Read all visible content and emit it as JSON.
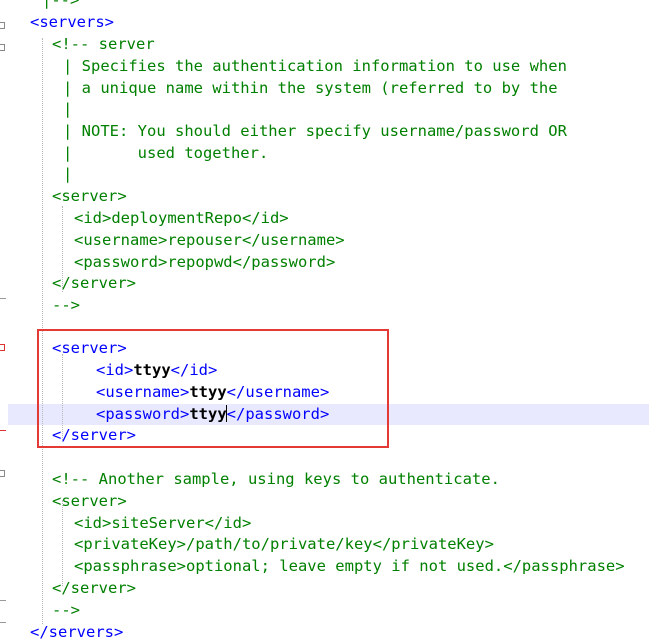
{
  "colors": {
    "tag": "#0000ff",
    "comment": "#008000",
    "text": "#000000",
    "current_line": "#e8e8ff",
    "annotation_box": "#e53935"
  },
  "editor": {
    "lines": [
      {
        "segments": [
          {
            "t": "|-->",
            "c": "cmt"
          }
        ]
      },
      {
        "segments": [
          {
            "t": "<servers>",
            "c": "tag"
          }
        ]
      },
      {
        "segments": [
          {
            "t": "<!-- server",
            "c": "cmt"
          }
        ]
      },
      {
        "segments": [
          {
            "t": "| Specifies the authentication information to use when",
            "c": "cmt"
          }
        ]
      },
      {
        "segments": [
          {
            "t": "| a unique name within the system (referred to by the",
            "c": "cmt"
          }
        ]
      },
      {
        "segments": [
          {
            "t": "|",
            "c": "cmt"
          }
        ]
      },
      {
        "segments": [
          {
            "t": "| NOTE: You should either specify username/password OR",
            "c": "cmt"
          }
        ]
      },
      {
        "segments": [
          {
            "t": "|       used together.",
            "c": "cmt"
          }
        ]
      },
      {
        "segments": [
          {
            "t": "|",
            "c": "cmt"
          }
        ]
      },
      {
        "segments": [
          {
            "t": "<server>",
            "c": "cmt"
          }
        ]
      },
      {
        "segments": [
          {
            "t": "<id>deploymentRepo</id>",
            "c": "cmt"
          }
        ]
      },
      {
        "segments": [
          {
            "t": "<username>repouser</username>",
            "c": "cmt"
          }
        ]
      },
      {
        "segments": [
          {
            "t": "<password>repopwd</password>",
            "c": "cmt"
          }
        ]
      },
      {
        "segments": [
          {
            "t": "</server>",
            "c": "cmt"
          }
        ]
      },
      {
        "segments": [
          {
            "t": "-->",
            "c": "cmt"
          }
        ]
      },
      {
        "segments": []
      },
      {
        "segments": [
          {
            "t": "<server>",
            "c": "tag"
          }
        ]
      },
      {
        "segments": [
          {
            "t": "<id>",
            "c": "tag"
          },
          {
            "t": "ttyy",
            "c": "txt"
          },
          {
            "t": "</id>",
            "c": "tag"
          }
        ]
      },
      {
        "segments": [
          {
            "t": "<username>",
            "c": "tag"
          },
          {
            "t": "ttyy",
            "c": "txt"
          },
          {
            "t": "</username>",
            "c": "tag"
          }
        ]
      },
      {
        "segments": [
          {
            "t": "<password>",
            "c": "tag"
          },
          {
            "t": "ttyy",
            "c": "txt"
          },
          {
            "t": "</password>",
            "c": "tag"
          }
        ]
      },
      {
        "segments": [
          {
            "t": "</server>",
            "c": "tag"
          }
        ]
      },
      {
        "segments": []
      },
      {
        "segments": [
          {
            "t": "<!-- Another sample, using keys to authenticate.",
            "c": "cmt"
          }
        ]
      },
      {
        "segments": [
          {
            "t": "<server>",
            "c": "cmt"
          }
        ]
      },
      {
        "segments": [
          {
            "t": "<id>siteServer</id>",
            "c": "cmt"
          }
        ]
      },
      {
        "segments": [
          {
            "t": "<privateKey>/path/to/private/key</privateKey>",
            "c": "cmt"
          }
        ]
      },
      {
        "segments": [
          {
            "t": "<passphrase>optional; leave empty if not used.</passphrase>",
            "c": "cmt"
          }
        ]
      },
      {
        "segments": [
          {
            "t": "</server>",
            "c": "cmt"
          }
        ]
      },
      {
        "segments": [
          {
            "t": "-->",
            "c": "cmt"
          }
        ]
      },
      {
        "segments": [
          {
            "t": "</servers>",
            "c": "tag"
          }
        ]
      }
    ]
  }
}
